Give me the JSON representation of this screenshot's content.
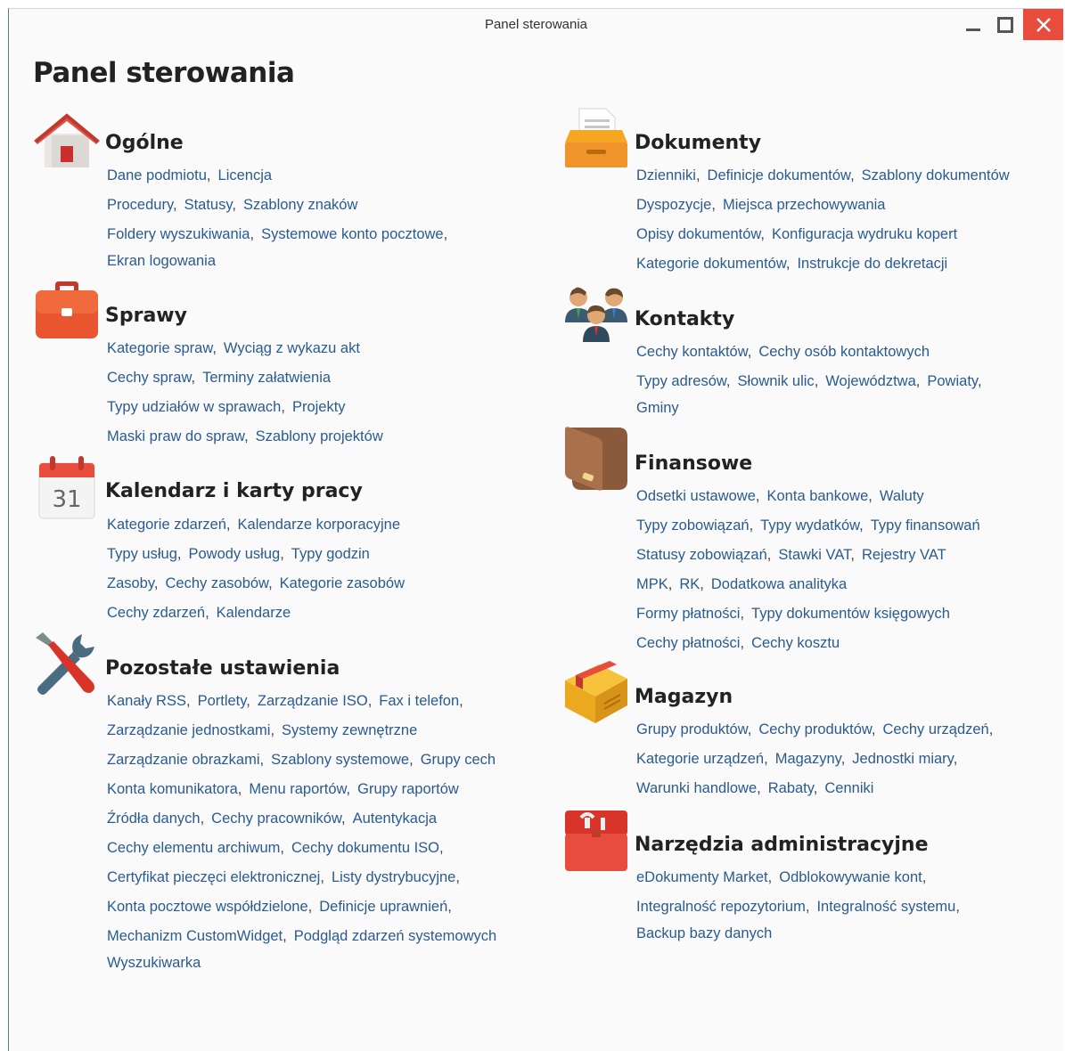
{
  "window": {
    "title": "Panel sterowania"
  },
  "page": {
    "title": "Panel sterowania"
  },
  "sections": {
    "ogolne": {
      "title": "Ogólne",
      "icon": "house-icon",
      "lines": [
        [
          "Dane podmiotu",
          "Licencja"
        ],
        [
          "Procedury",
          "Statusy",
          "Szablony znaków"
        ],
        [
          "Foldery wyszukiwania",
          "Systemowe konto pocztowe"
        ],
        [
          "Ekran logowania"
        ]
      ]
    },
    "sprawy": {
      "title": "Sprawy",
      "icon": "briefcase-icon",
      "lines": [
        [
          "Kategorie spraw",
          "Wyciąg z wykazu akt"
        ],
        [
          "Cechy spraw",
          "Terminy załatwienia"
        ],
        [
          "Typy udziałów w sprawach",
          "Projekty"
        ],
        [
          "Maski praw do spraw",
          "Szablony projektów"
        ]
      ]
    },
    "kalendarz": {
      "title": "Kalendarz i karty pracy",
      "icon": "calendar-icon",
      "icon_day": "31",
      "lines": [
        [
          "Kategorie zdarzeń",
          "Kalendarze korporacyjne"
        ],
        [
          "Typy usług",
          "Powody usług",
          "Typy godzin"
        ],
        [
          "Zasoby",
          "Cechy zasobów",
          "Kategorie zasobów"
        ],
        [
          "Cechy zdarzeń",
          "Kalendarze"
        ]
      ]
    },
    "pozostale": {
      "title": "Pozostałe ustawienia",
      "icon": "tools-icon",
      "lines": [
        [
          "Kanały RSS",
          "Portlety",
          "Zarządzanie ISO",
          "Fax i telefon"
        ],
        [
          "Zarządzanie jednostkami",
          "Systemy zewnętrzne"
        ],
        [
          "Zarządzanie obrazkami",
          "Szablony systemowe",
          "Grupy cech"
        ],
        [
          "Konta komunikatora",
          "Menu raportów",
          "Grupy raportów"
        ],
        [
          "Źródła danych",
          "Cechy pracowników",
          "Autentykacja"
        ],
        [
          "Cechy elementu archiwum",
          "Cechy dokumentu ISO"
        ],
        [
          "Certyfikat pieczęci elektronicznej",
          "Listy dystrybucyjne"
        ],
        [
          "Konta pocztowe współdzielone",
          "Definicje uprawnień"
        ],
        [
          "Mechanizm CustomWidget",
          "Podgląd zdarzeń systemowych"
        ],
        [
          "Wyszukiwarka"
        ]
      ]
    },
    "dokumenty": {
      "title": "Dokumenty",
      "icon": "document-tray-icon",
      "lines": [
        [
          "Dzienniki",
          "Definicje dokumentów",
          "Szablony dokumentów"
        ],
        [
          "Dyspozycje",
          "Miejsca przechowywania"
        ],
        [
          "Opisy dokumentów",
          "Konfiguracja wydruku kopert"
        ],
        [
          "Kategorie dokumentów",
          "Instrukcje do dekretacji"
        ]
      ]
    },
    "kontakty": {
      "title": "Kontakty",
      "icon": "contacts-icon",
      "lines": [
        [
          "Cechy kontaktów",
          "Cechy osób kontaktowych"
        ],
        [
          "Typy adresów",
          "Słownik ulic",
          "Województwa",
          "Powiaty"
        ],
        [
          "Gminy"
        ]
      ]
    },
    "finansowe": {
      "title": "Finansowe",
      "icon": "wallet-icon",
      "lines": [
        [
          "Odsetki ustawowe",
          "Konta bankowe",
          "Waluty"
        ],
        [
          "Typy zobowiązań",
          "Typy wydatków",
          "Typy finansowań"
        ],
        [
          "Statusy zobowiązań",
          "Stawki VAT",
          "Rejestry VAT"
        ],
        [
          "MPK",
          "RK",
          "Dodatkowa analityka"
        ],
        [
          "Formy płatności",
          "Typy dokumentów księgowych"
        ],
        [
          "Cechy płatności",
          "Cechy kosztu"
        ]
      ]
    },
    "magazyn": {
      "title": "Magazyn",
      "icon": "package-icon",
      "lines": [
        [
          "Grupy produktów",
          "Cechy produktów",
          "Cechy urządzeń"
        ],
        [
          "Kategorie urządzeń",
          "Magazyny",
          "Jednostki miary"
        ],
        [
          "Warunki handlowe",
          "Rabaty",
          "Cenniki"
        ]
      ]
    },
    "narzedzia": {
      "title": "Narzędzia administracyjne",
      "icon": "toolbox-icon",
      "lines": [
        [
          "eDokumenty Market",
          "Odblokowywanie kont"
        ],
        [
          "Integralność repozytorium",
          "Integralność systemu"
        ],
        [
          "Backup bazy danych"
        ]
      ]
    }
  }
}
